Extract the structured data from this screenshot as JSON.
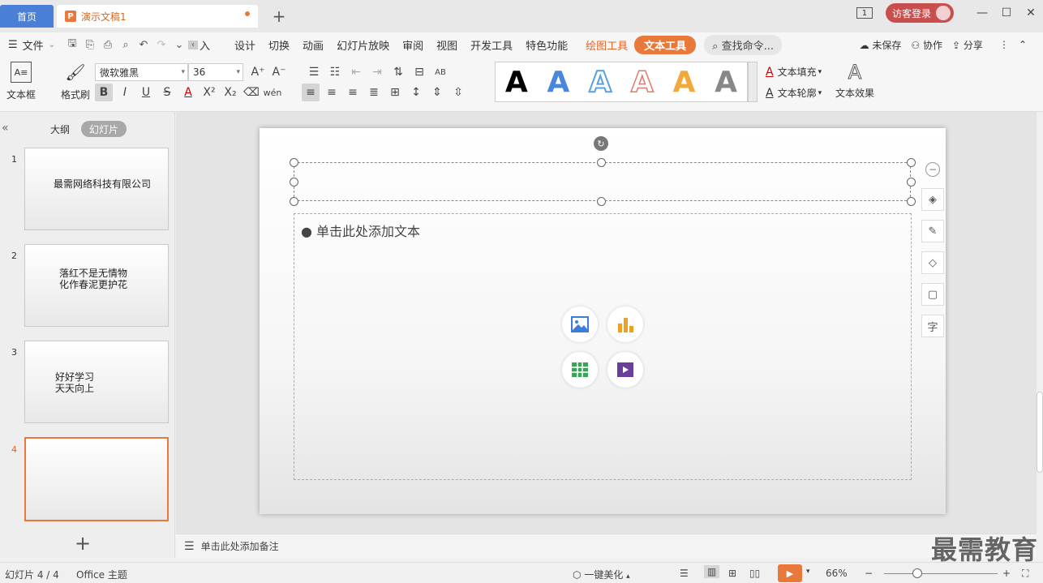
{
  "tabs": {
    "home": "首页",
    "doc": "演示文稿1"
  },
  "titlebar": {
    "slide_count_badge": "1",
    "visitor_login": "访客登录"
  },
  "menu": {
    "file": "文件",
    "tabs": [
      "入",
      "设计",
      "切换",
      "动画",
      "幻灯片放映",
      "审阅",
      "视图",
      "开发工具",
      "特色功能"
    ],
    "drawing_tools": "绘图工具",
    "text_tools": "文本工具",
    "search": "查找命令...",
    "unsaved": "未保存",
    "collab": "协作",
    "share": "分享"
  },
  "ribbon": {
    "textbox": "文本框",
    "format_painter": "格式刷",
    "font_name": "微软雅黑",
    "font_size": "36",
    "text_fill": "文本填充",
    "text_outline": "文本轮廓",
    "text_effect": "文本效果",
    "wordart_glyph": "A"
  },
  "panel": {
    "outline_tab": "大纲",
    "slides_tab": "幻灯片",
    "slides": [
      {
        "num": "1",
        "lines": [
          "最需网络科技有限公司"
        ]
      },
      {
        "num": "2",
        "lines": [
          "落红不是无情物",
          "化作春泥更护花"
        ]
      },
      {
        "num": "3",
        "lines": [
          "好好学习",
          "天天向上"
        ]
      },
      {
        "num": "4",
        "lines": []
      }
    ]
  },
  "slide": {
    "placeholder": "单击此处添加文本"
  },
  "notes": {
    "placeholder": "单击此处添加备注"
  },
  "status": {
    "slide_pos": "幻灯片 4 / 4",
    "theme": "Office 主题",
    "beautify": "一键美化",
    "zoom": "66%"
  },
  "watermark": "最需教育",
  "colors": {
    "accent": "#e8793a",
    "home_tab": "#4a7fd6",
    "visitor": "#c94f4f"
  }
}
